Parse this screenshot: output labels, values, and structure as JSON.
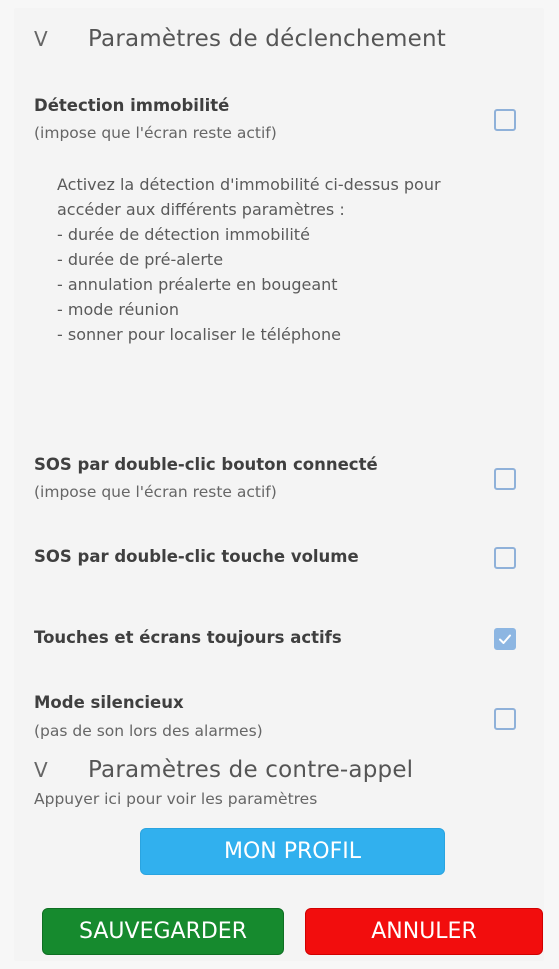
{
  "trigger_section": {
    "chevron": "V",
    "title": "Paramètres de déclenchement"
  },
  "settings": [
    {
      "title": "Détection immobilité",
      "subtitle": "(impose que l'écran reste actif)",
      "checked": false
    },
    {
      "title": "SOS par double-clic bouton connecté",
      "subtitle": "(impose que l'écran reste actif)",
      "checked": false
    },
    {
      "title": "SOS par double-clic touche volume",
      "subtitle": "",
      "checked": false
    },
    {
      "title": "Touches et écrans toujours actifs",
      "subtitle": "",
      "checked": true
    },
    {
      "title": "Mode silencieux",
      "subtitle": "(pas de son lors des alarmes)",
      "checked": false
    }
  ],
  "info": {
    "intro_line1": "Activez la détection d'immobilité ci-dessus pour",
    "intro_line2": "accéder aux différents paramètres :",
    "items": [
      "- durée de détection immobilité",
      "- durée de pré-alerte",
      "- annulation préalerte en bougeant",
      "- mode réunion",
      "- sonner pour localiser le téléphone"
    ]
  },
  "callback_section": {
    "chevron": "V",
    "title": "Paramètres de contre-appel",
    "hint": "Appuyer ici pour voir les paramètres"
  },
  "buttons": {
    "profile": "MON PROFIL",
    "save": "SAUVEGARDER",
    "cancel": "ANNULER"
  },
  "colors": {
    "profile_button": "#31b0ee",
    "save_button": "#168a2e",
    "cancel_button": "#f20d0d",
    "checkbox_border": "#8fb1d9",
    "checkbox_checked": "#8db6e2"
  }
}
